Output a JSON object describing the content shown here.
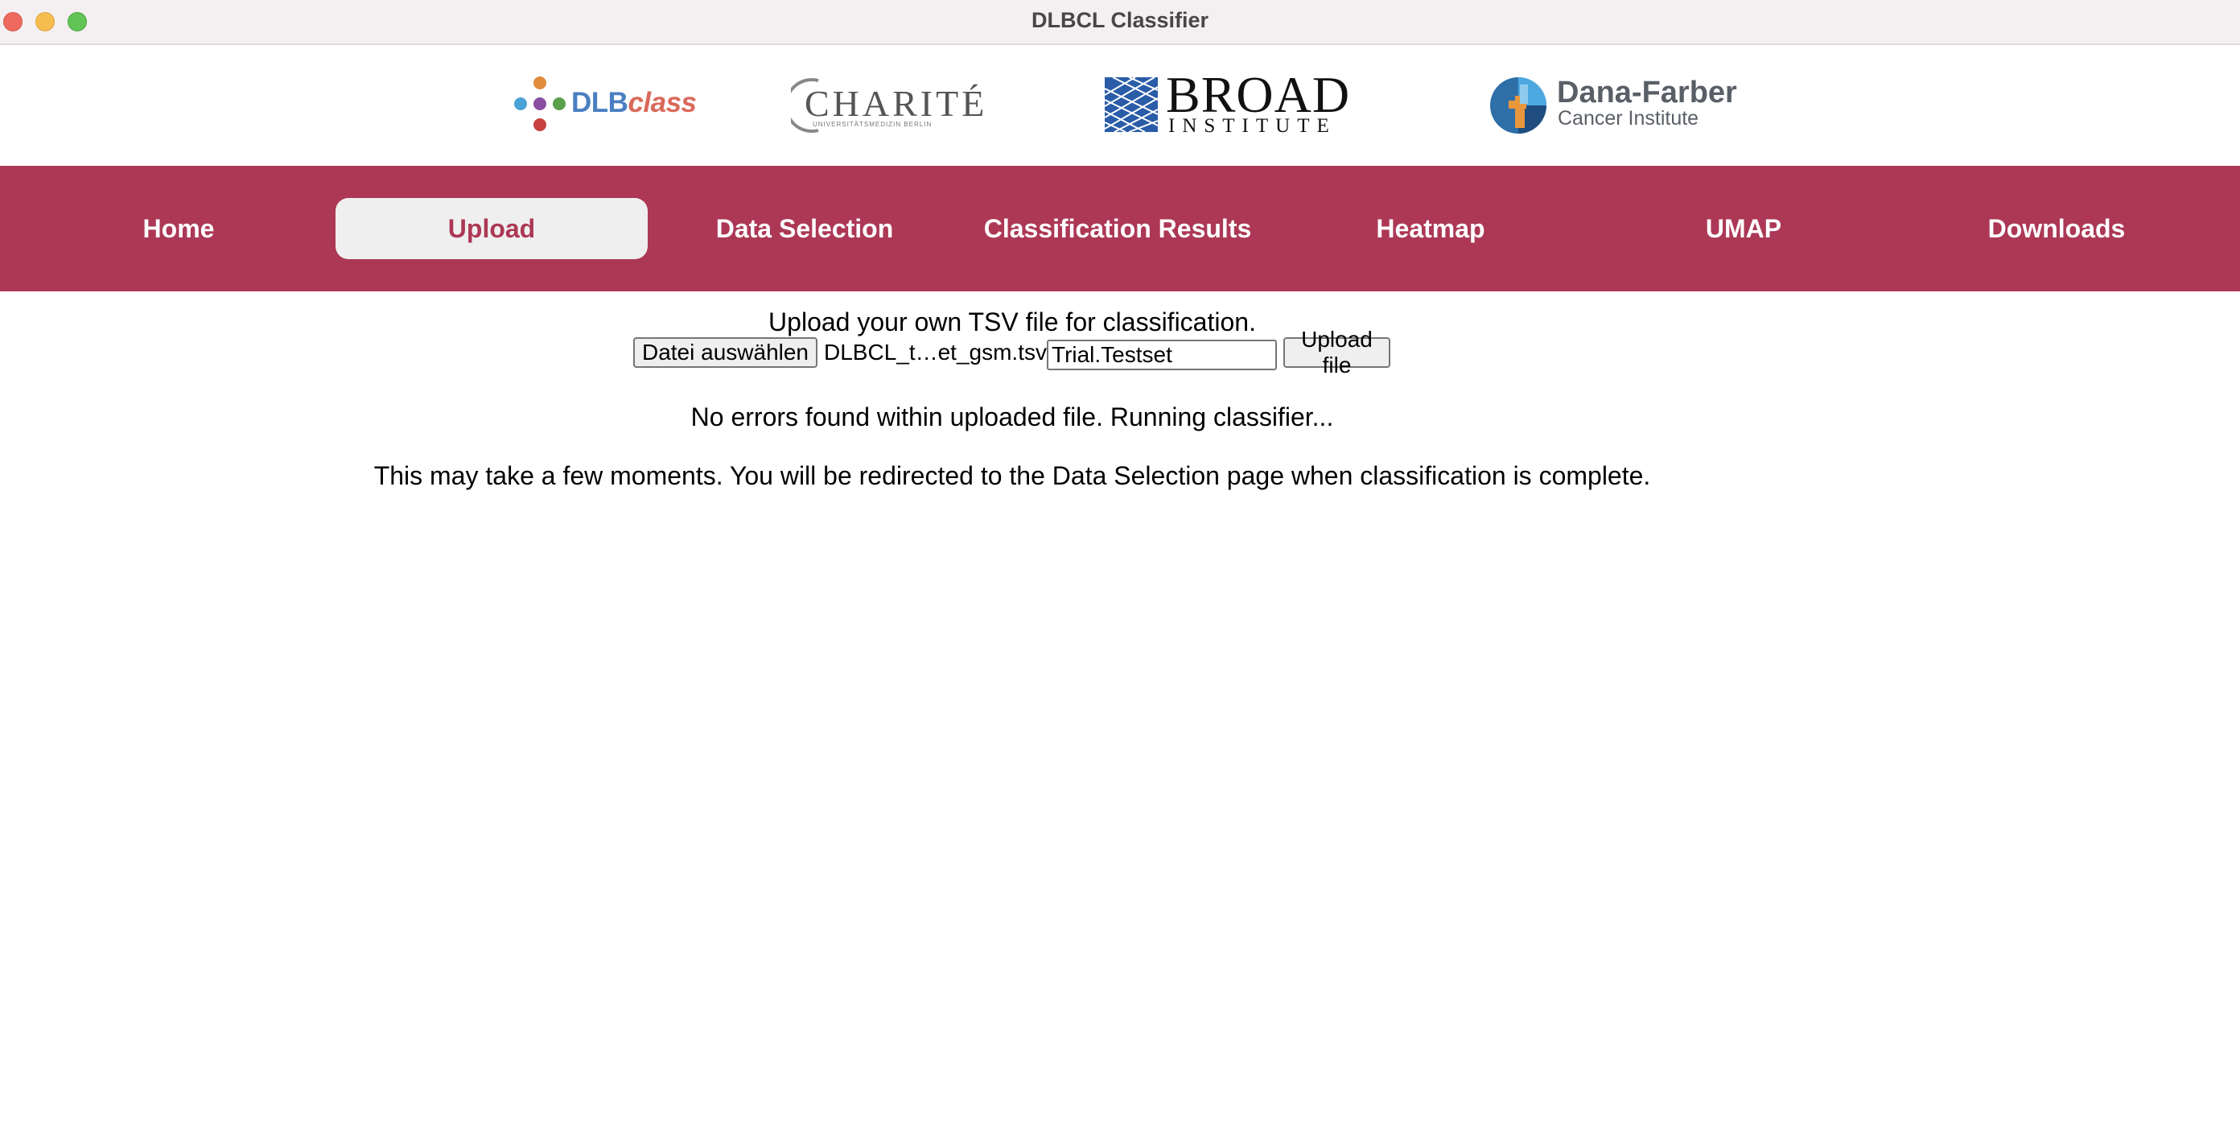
{
  "window": {
    "title": "DLBCL Classifier"
  },
  "logos": {
    "dlbclass": {
      "part1": "DLB",
      "part2": "class"
    },
    "charite": {
      "main": "CHARITÉ",
      "sub": "UNIVERSITÄTSMEDIZIN BERLIN"
    },
    "broad": {
      "main": "BROAD",
      "sub": "INSTITUTE"
    },
    "dana_farber": {
      "main": "Dana-Farber",
      "sub": "Cancer Institute"
    }
  },
  "nav": {
    "items": [
      {
        "label": "Home"
      },
      {
        "label": "Upload",
        "active": true
      },
      {
        "label": "Data Selection"
      },
      {
        "label": "Classification Results"
      },
      {
        "label": "Heatmap"
      },
      {
        "label": "UMAP"
      },
      {
        "label": "Downloads"
      }
    ],
    "accent": "#ac3855"
  },
  "upload": {
    "heading": "Upload your own TSV file for classification.",
    "choose_file_label": "Datei auswählen",
    "selected_file": "DLBCL_t…et_gsm.tsv",
    "dataset_name_value": "Trial.Testset",
    "upload_button_label": "Upload file"
  },
  "status": {
    "message1": "No errors found within uploaded file. Running classifier...",
    "message2": "This may take a few moments. You will be redirected to the Data Selection page when classification is complete."
  }
}
